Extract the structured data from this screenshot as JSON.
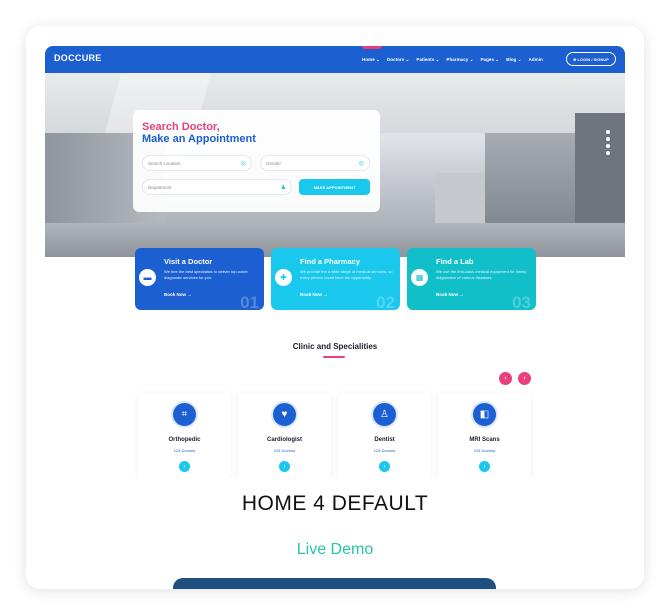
{
  "caption": "HOME 4 DEFAULT",
  "demo_link": "Live Demo",
  "preview": {
    "logo": "DOCCURE",
    "menu": [
      "Home ⌄",
      "Doctors ⌄",
      "Patients ⌄",
      "Pharmacy ⌄",
      "Pages ⌄",
      "Blog ⌄",
      "Admin"
    ],
    "login": "⊕ LOGIN / SIGNUP",
    "search": {
      "title1": "Search Doctor,",
      "title2": "Make an Appointment",
      "location_placeholder": "Search Location",
      "gender_placeholder": "Gender",
      "department_placeholder": "Department",
      "button": "MAKE APPOINTMENT"
    },
    "services": [
      {
        "title": "Visit a Doctor",
        "desc": "We hire the best specialists to deliver top-notch diagnostic services for you.",
        "link": "Book Now →",
        "num": "01",
        "color": "#1c5fd0"
      },
      {
        "title": "Find a Pharmacy",
        "desc": "We provide the a wide range of medical services, so every person could have the opportunity.",
        "link": "Book Now →",
        "num": "02",
        "color": "#19c8ec"
      },
      {
        "title": "Find a Lab",
        "desc": "We use the first-class medical equipment for timely diagnostics of various diseases.",
        "link": "Book Now →",
        "num": "03",
        "color": "#11bfc9"
      }
    ],
    "clinic_title": "Clinic and Specialities",
    "specialities": [
      {
        "name": "Orthopedic",
        "count": "124 Doctors"
      },
      {
        "name": "Cardiologist",
        "count": "124 Doctors"
      },
      {
        "name": "Dentist",
        "count": "124 Doctors"
      },
      {
        "name": "MRI Scans",
        "count": "124 Doctors"
      }
    ]
  }
}
